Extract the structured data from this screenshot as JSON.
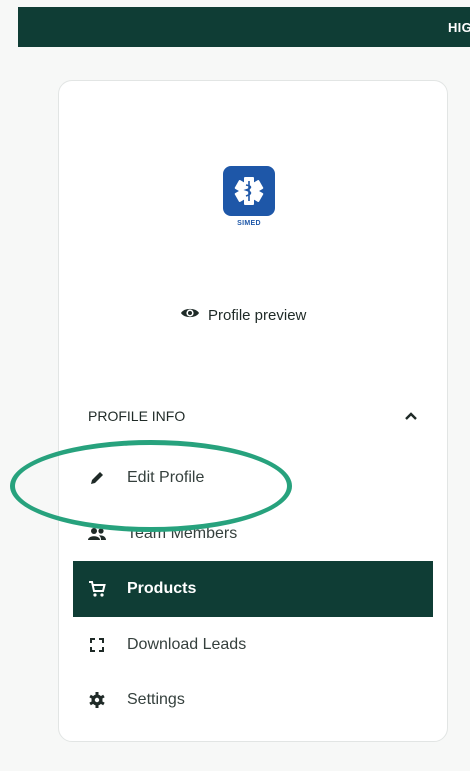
{
  "topbar": {
    "text": "HIG"
  },
  "logo": {
    "caption": "SIMED"
  },
  "profile_preview": {
    "label": "Profile preview"
  },
  "section": {
    "title": "PROFILE INFO"
  },
  "menu": {
    "edit_profile": "Edit Profile",
    "team_members": "Team Members",
    "products": "Products",
    "download_leads": "Download Leads",
    "settings": "Settings"
  },
  "colors": {
    "brand_dark": "#0f3d35",
    "logo_blue": "#1e57a8",
    "annotation": "#27a27d"
  }
}
